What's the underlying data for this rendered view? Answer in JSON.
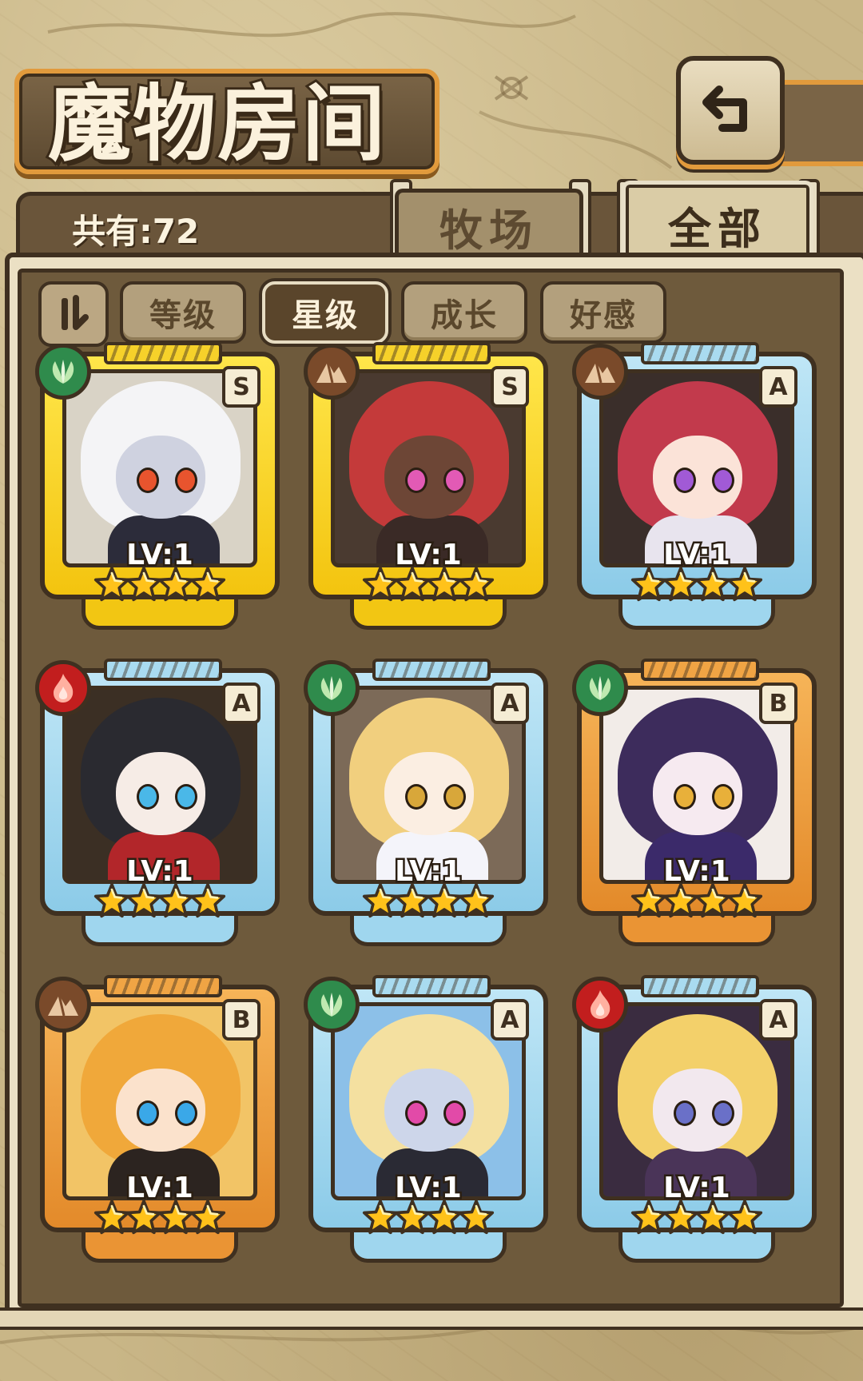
{
  "header": {
    "title": "魔物房间",
    "count_label": "共有:72"
  },
  "tabs": [
    {
      "label": "牧场",
      "active": false
    },
    {
      "label": "全部",
      "active": true
    }
  ],
  "sort": {
    "toggle_icon": "sort-order-icon",
    "buttons": [
      {
        "label": "等级",
        "active": false
      },
      {
        "label": "星级",
        "active": true
      },
      {
        "label": "成长",
        "active": false
      },
      {
        "label": "好感",
        "active": false
      }
    ]
  },
  "colors": {
    "frame_gold": "#f3c40f",
    "frame_blue": "#8ccbe8",
    "frame_orange": "#e38a2a",
    "element_nature": "#2f8b4c",
    "element_earth": "#7a4a2a",
    "element_fire": "#c21e1e",
    "star": "#ffc21a"
  },
  "monsters": [
    {
      "rank": "S",
      "level": "LV:1",
      "stars": 4,
      "element": "nature",
      "frame": "gold"
    },
    {
      "rank": "S",
      "level": "LV:1",
      "stars": 4,
      "element": "earth",
      "frame": "gold"
    },
    {
      "rank": "A",
      "level": "LV:1",
      "stars": 4,
      "element": "earth",
      "frame": "blue"
    },
    {
      "rank": "A",
      "level": "LV:1",
      "stars": 4,
      "element": "fire",
      "frame": "blue"
    },
    {
      "rank": "A",
      "level": "LV:1",
      "stars": 4,
      "element": "nature",
      "frame": "blue"
    },
    {
      "rank": "B",
      "level": "LV:1",
      "stars": 4,
      "element": "nature",
      "frame": "orange"
    },
    {
      "rank": "B",
      "level": "LV:1",
      "stars": 4,
      "element": "earth",
      "frame": "orange"
    },
    {
      "rank": "A",
      "level": "LV:1",
      "stars": 4,
      "element": "nature",
      "frame": "blue"
    },
    {
      "rank": "A",
      "level": "LV:1",
      "stars": 4,
      "element": "fire",
      "frame": "blue"
    }
  ]
}
